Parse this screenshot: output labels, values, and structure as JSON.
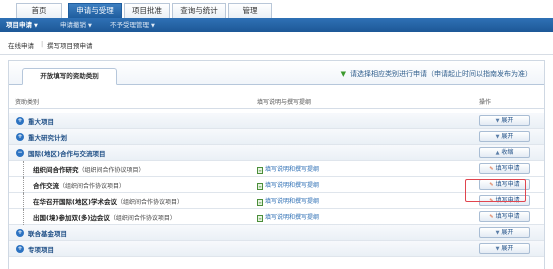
{
  "top_tabs": [
    {
      "label": "首页"
    },
    {
      "label": "申请与受理"
    },
    {
      "label": "项目批准"
    },
    {
      "label": "查询与统计"
    },
    {
      "label": "管理"
    }
  ],
  "menu": [
    {
      "label": "项目申请"
    },
    {
      "label": "申请撤销"
    },
    {
      "label": "不予受理管理"
    }
  ],
  "subnav": {
    "item1": "在线申请",
    "separator": "|",
    "item2": "撰写项目预申请"
  },
  "panel": {
    "tab_label": "开放填写的资助类别",
    "note": "请选择相应类别进行申请（申请起止时间以指南发布为准）"
  },
  "table_header": {
    "col1": "资助类别",
    "col2": "填写说明与撰写提纲",
    "col3": "操作"
  },
  "rows": [
    {
      "title": "重大项目",
      "action": "展开"
    },
    {
      "title": "重大研究计划",
      "action": "展开"
    },
    {
      "title": "国际(地区)合作与交流项目",
      "action": "收缩"
    },
    {
      "title": "组织间合作研究",
      "paren": "（组织间合作协议项目）",
      "guide": "填写说明和撰写提纲",
      "action": "填写申请"
    },
    {
      "title": "合作交流",
      "paren": "（组织间合作协议项目）",
      "guide": "填写说明和撰写提纲",
      "action": "填写申请"
    },
    {
      "title": "在华召开国际(地区)学术会议",
      "paren": "（组织间合作协议项目）",
      "guide": "填写说明和撰写提纲",
      "action": "填写申请"
    },
    {
      "title": "出国(境)参加双(多)边会议",
      "paren": "（组织间合作协议项目）",
      "guide": "填写说明和撰写提纲",
      "action": "填写申请"
    },
    {
      "title": "联合基金项目",
      "action": "展开"
    },
    {
      "title": "专项项目",
      "action": "展开"
    }
  ]
}
